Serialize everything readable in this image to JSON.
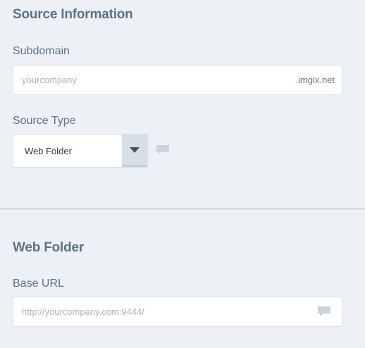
{
  "source_info": {
    "title": "Source Information",
    "subdomain_label": "Subdomain",
    "subdomain_placeholder": "yourcompany",
    "subdomain_value": "",
    "subdomain_suffix": ".imgix.net",
    "source_type_label": "Source Type",
    "source_type_value": "Web Folder"
  },
  "web_folder": {
    "title": "Web Folder",
    "base_url_label": "Base URL",
    "base_url_placeholder": "http://yourcompany.com:9444/",
    "base_url_value": ""
  },
  "colors": {
    "background": "#edf1f5",
    "heading": "#5d7286",
    "placeholder": "#a7b6c4",
    "icon": "#c7d4df"
  },
  "icons": {
    "dropdown": "caret-down-icon",
    "comment": "comment-icon"
  }
}
